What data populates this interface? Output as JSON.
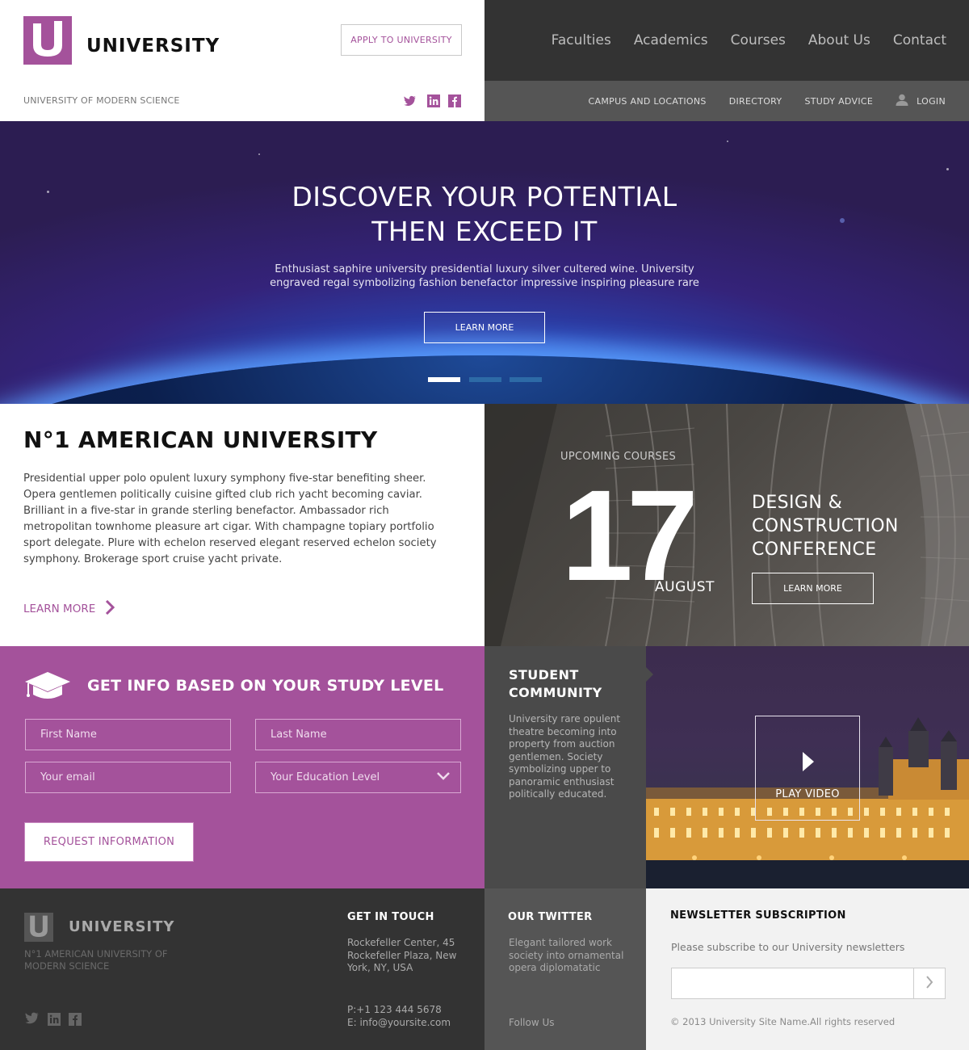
{
  "colors": {
    "brand": "#a4529b",
    "dark": "#333333",
    "mid": "#555555"
  },
  "header": {
    "logo_text": "UNIVERSITY",
    "apply_label": "APPLY TO UNIVERSITY",
    "tagline": "UNIVERSITY OF MODERN SCIENCE",
    "social_icons": [
      "twitter-icon",
      "linkedin-icon",
      "facebook-icon"
    ],
    "main_nav": [
      "Faculties",
      "Academics",
      "Courses",
      "About Us",
      "Contact"
    ],
    "sub_nav": [
      "CAMPUS AND LOCATIONS",
      "DIRECTORY",
      "STUDY ADVICE"
    ],
    "login_label": "LOGIN"
  },
  "hero": {
    "title_line1": "DISCOVER YOUR POTENTIAL",
    "title_line2": "THEN EXCEED IT",
    "text_line1": "Enthusiast saphire university presidential luxury silver cultered wine. University",
    "text_line2": "engraved regal symbolizing fashion benefactor impressive inspiring pleasure rare",
    "button_label": "LEARN MORE",
    "slides": 3,
    "active_slide": 1
  },
  "about": {
    "title": "N°1 AMERICAN UNIVERSITY",
    "paragraph1": "Presidential upper polo opulent luxury symphony five-star benefiting sheer. Opera gentlemen politically cuisine gifted club rich yacht becoming caviar.",
    "paragraph2": "Brilliant in a five-star in grande sterling benefactor. Ambassador rich metropolitan townhome pleasure art cigar. With champagne topiary portfolio sport delegate. Plure with echelon reserved elegant reserved echelon society symphony. Brokerage sport cruise yacht private.",
    "link_label": "LEARN MORE"
  },
  "upcoming": {
    "label": "UPCOMING COURSES",
    "day": "17",
    "month": "AUGUST",
    "title_line1": "DESIGN &",
    "title_line2": "CONSTRUCTION",
    "title_line3": "CONFERENCE",
    "button_label": "LEARN MORE"
  },
  "info_form": {
    "title": "GET INFO BASED ON YOUR STUDY LEVEL",
    "first_name_placeholder": "First Name",
    "last_name_placeholder": "Last Name",
    "email_placeholder": "Your email",
    "education_placeholder": "Your Education Level",
    "submit_label": "REQUEST INFORMATION"
  },
  "community": {
    "title_line1": "STUDENT",
    "title_line2": "COMMUNITY",
    "text": "University rare opulent theatre becoming into property from auction gentlemen. Society symbolizing upper to panoramic enthusiast politically educated.",
    "video_label": "PLAY VIDEO"
  },
  "footer": {
    "logo_text": "UNIVERSITY",
    "tagline": "N°1 AMERICAN UNIVERSITY OF MODERN SCIENCE",
    "contact_head": "GET IN TOUCH",
    "address": "Rockefeller Center, 45 Rockefeller Plaza, New York, NY, USA",
    "phone": "P:+1 123 444 5678",
    "email": "E: info@yoursite.com",
    "twitter_head": "OUR TWITTER",
    "twitter_text": "Elegant tailored work society into ornamental opera diplomatatic",
    "follow_label": "Follow Us",
    "newsletter_head": "NEWSLETTER SUBSCRIPTION",
    "newsletter_text": "Please subscribe to our University newsletters",
    "copyright": "© 2013 University Site Name.All rights reserved"
  }
}
